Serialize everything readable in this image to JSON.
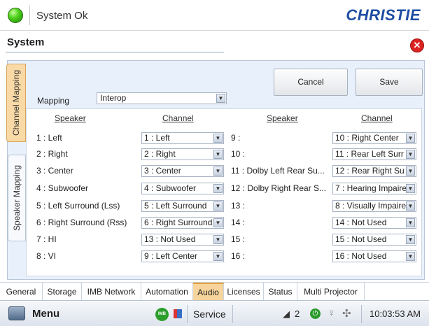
{
  "header": {
    "status_text": "System Ok",
    "brand": "CHRISTIE",
    "page_title": "System",
    "close_symbol": "✕"
  },
  "side_tabs": {
    "channel_mapping": "Channel Mapping",
    "speaker_mapping": "Speaker Mapping"
  },
  "mapping": {
    "label": "Mapping",
    "value": "Interop"
  },
  "buttons": {
    "cancel": "Cancel",
    "save": "Save"
  },
  "columns": {
    "speaker": "Speaker",
    "channel": "Channel"
  },
  "left_rows": [
    {
      "speaker": "1 : Left",
      "channel": "1 : Left"
    },
    {
      "speaker": "2 : Right",
      "channel": "2 : Right"
    },
    {
      "speaker": "3 : Center",
      "channel": "3 : Center"
    },
    {
      "speaker": "4 : Subwoofer",
      "channel": "4 : Subwoofer"
    },
    {
      "speaker": "5 : Left Surround (Lss)",
      "channel": "5 : Left Surround"
    },
    {
      "speaker": "6 : Right Surround (Rss)",
      "channel": "6 : Right Surround"
    },
    {
      "speaker": "7 : HI",
      "channel": "13 : Not Used"
    },
    {
      "speaker": "8 : VI",
      "channel": "9 : Left Center"
    }
  ],
  "right_rows": [
    {
      "speaker": "9 :",
      "channel": "10 : Right Center"
    },
    {
      "speaker": "10 :",
      "channel": "11 : Rear Left Surr"
    },
    {
      "speaker": "11 : Dolby Left Rear Su...",
      "channel": "12 : Rear Right Su"
    },
    {
      "speaker": "12 : Dolby Right Rear S...",
      "channel": "7 : Hearing Impaire"
    },
    {
      "speaker": "13 :",
      "channel": "8 : Visually Impaire"
    },
    {
      "speaker": "14 :",
      "channel": "14 : Not Used"
    },
    {
      "speaker": "15 :",
      "channel": "15 : Not Used"
    },
    {
      "speaker": "16 :",
      "channel": "16 : Not Used"
    }
  ],
  "bottom_tabs": [
    "General",
    "Storage",
    "IMB Network",
    "Automation",
    "Audio",
    "Licenses",
    "Status",
    "Multi Projector"
  ],
  "active_tab": "Audio",
  "footer": {
    "menu_label": "Menu",
    "imb_badge": "IMB",
    "service_label": "Service",
    "distribution_count": "2",
    "time": "10:03:53 AM"
  },
  "colors": {
    "accent_tab": "#f7d49c",
    "brand_blue": "#1f4ea3",
    "status_green": "#4fd11c",
    "panel_bg": "#e8f0fb"
  },
  "icons": {
    "status": "status-ok-icon",
    "close": "close-icon",
    "menu": "projector-icon",
    "imb": "imb-icon",
    "power": "power-icon",
    "bulb": "lamp-icon",
    "fan": "fan-icon",
    "distribution": "distribution-icon"
  }
}
